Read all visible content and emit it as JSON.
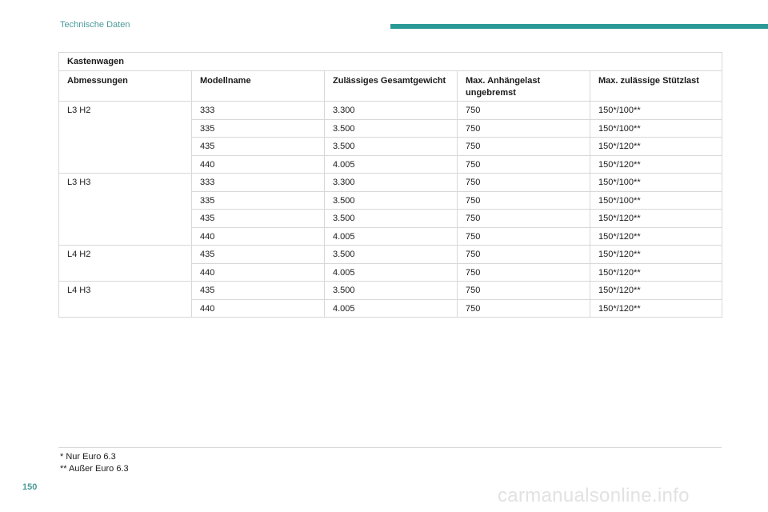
{
  "header": {
    "title": "Technische Daten",
    "accent_color": "#2a9a97"
  },
  "table": {
    "caption": "Kastenwagen",
    "columns": [
      "Abmessungen",
      "Modellname",
      "Zulässiges Gesamtgewicht",
      "Max. Anhängelast ungebremst",
      "Max. zulässige Stützlast"
    ],
    "groups": [
      {
        "dimension": "L3 H2",
        "rows": [
          [
            "333",
            "3.300",
            "750",
            "150*/100**"
          ],
          [
            "335",
            "3.500",
            "750",
            "150*/100**"
          ],
          [
            "435",
            "3.500",
            "750",
            "150*/120**"
          ],
          [
            "440",
            "4.005",
            "750",
            "150*/120**"
          ]
        ]
      },
      {
        "dimension": "L3 H3",
        "rows": [
          [
            "333",
            "3.300",
            "750",
            "150*/100**"
          ],
          [
            "335",
            "3.500",
            "750",
            "150*/100**"
          ],
          [
            "435",
            "3.500",
            "750",
            "150*/120**"
          ],
          [
            "440",
            "4.005",
            "750",
            "150*/120**"
          ]
        ]
      },
      {
        "dimension": "L4 H2",
        "rows": [
          [
            "435",
            "3.500",
            "750",
            "150*/120**"
          ],
          [
            "440",
            "4.005",
            "750",
            "150*/120**"
          ]
        ]
      },
      {
        "dimension": "L4 H3",
        "rows": [
          [
            "435",
            "3.500",
            "750",
            "150*/120**"
          ],
          [
            "440",
            "4.005",
            "750",
            "150*/120**"
          ]
        ]
      }
    ]
  },
  "footnotes": [
    "* Nur Euro 6.3",
    "** Außer Euro 6.3"
  ],
  "page_number": "150",
  "watermark": "carmanualsonline.info"
}
